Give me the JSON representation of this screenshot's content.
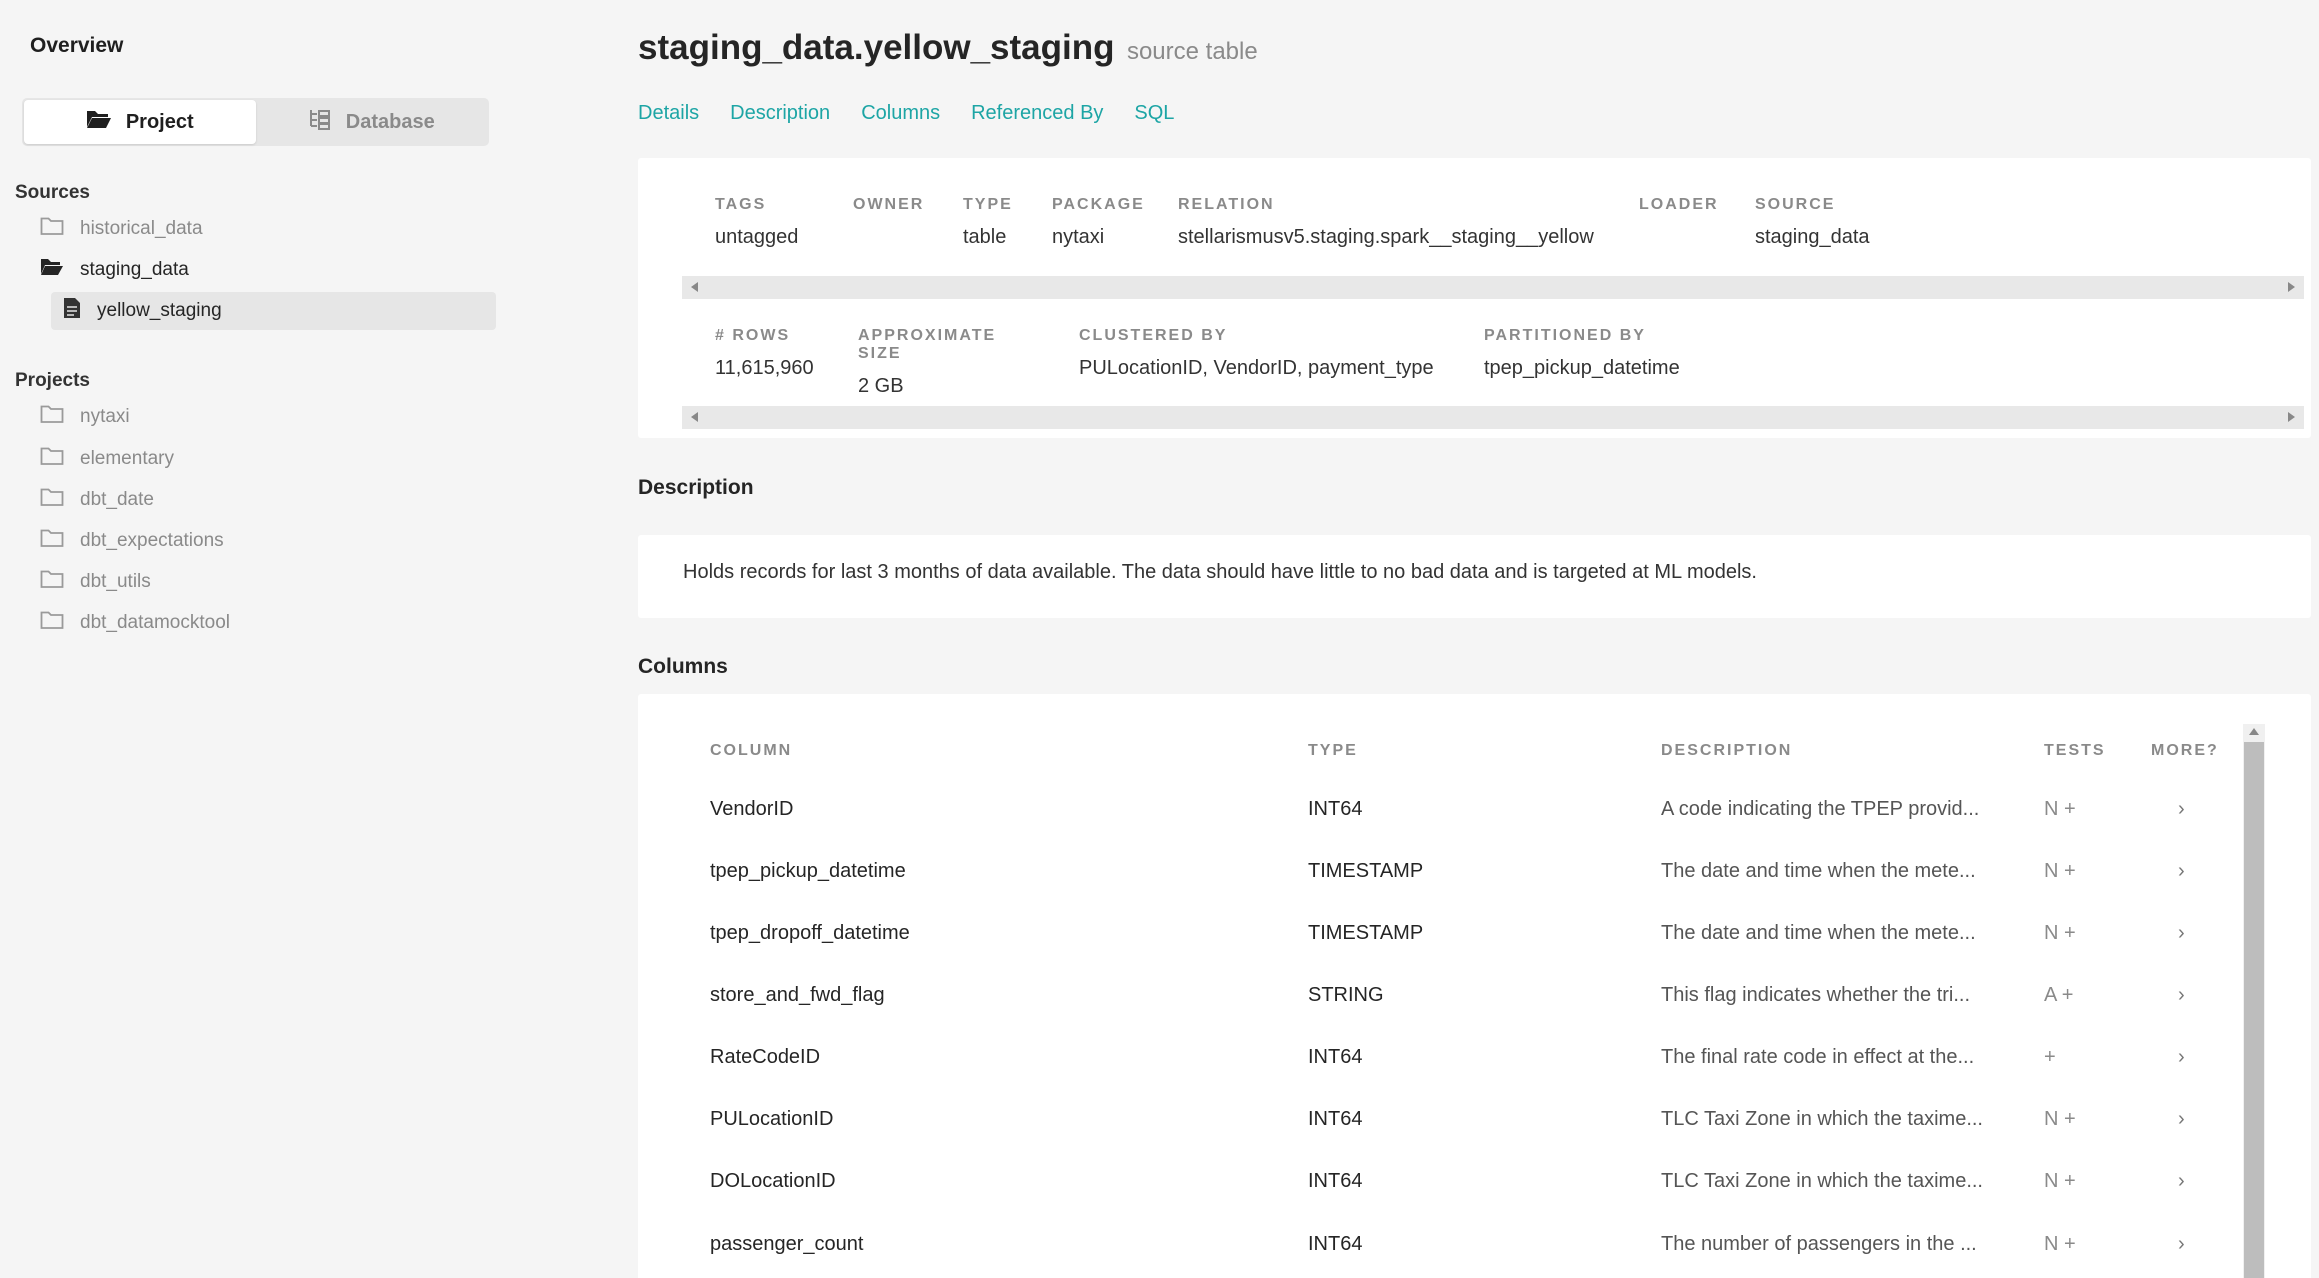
{
  "sidebar": {
    "overview": "Overview",
    "switch": {
      "project": "Project",
      "database": "Database"
    },
    "sources_title": "Sources",
    "sources": [
      {
        "label": "historical_data"
      },
      {
        "label": "staging_data"
      },
      {
        "label": "yellow_staging"
      }
    ],
    "projects_title": "Projects",
    "projects": [
      {
        "label": "nytaxi"
      },
      {
        "label": "elementary"
      },
      {
        "label": "dbt_date"
      },
      {
        "label": "dbt_expectations"
      },
      {
        "label": "dbt_utils"
      },
      {
        "label": "dbt_datamocktool"
      }
    ]
  },
  "header": {
    "title": "staging_data.yellow_staging",
    "subtitle": "source table",
    "tabs": [
      "Details",
      "Description",
      "Columns",
      "Referenced By",
      "SQL"
    ]
  },
  "details": {
    "row1": [
      {
        "label": "TAGS",
        "value": "untagged"
      },
      {
        "label": "OWNER",
        "value": ""
      },
      {
        "label": "TYPE",
        "value": "table"
      },
      {
        "label": "PACKAGE",
        "value": "nytaxi"
      },
      {
        "label": "RELATION",
        "value": "stellarismusv5.staging.spark__staging__yellow"
      },
      {
        "label": "LOADER",
        "value": ""
      },
      {
        "label": "SOURCE",
        "value": "staging_data"
      }
    ],
    "row2": [
      {
        "label": "# ROWS",
        "value": "11,615,960"
      },
      {
        "label": "APPROXIMATE SIZE",
        "value": "2 GB"
      },
      {
        "label": "CLUSTERED BY",
        "value": "PULocationID, VendorID, payment_type"
      },
      {
        "label": "PARTITIONED BY",
        "value": "tpep_pickup_datetime"
      }
    ]
  },
  "description": {
    "heading": "Description",
    "text": "Holds records for last 3 months of data available. The data should have little to no bad data and is targeted at ML models."
  },
  "columns": {
    "heading": "Columns",
    "headers": {
      "column": "COLUMN",
      "type": "TYPE",
      "description": "DESCRIPTION",
      "tests": "TESTS",
      "more": "MORE?"
    },
    "rows": [
      {
        "name": "VendorID",
        "type": "INT64",
        "description": "A code indicating the TPEP provid...",
        "tests": "N +",
        "more": "›"
      },
      {
        "name": "tpep_pickup_datetime",
        "type": "TIMESTAMP",
        "description": "The date and time when the mete...",
        "tests": "N +",
        "more": "›"
      },
      {
        "name": "tpep_dropoff_datetime",
        "type": "TIMESTAMP",
        "description": "The date and time when the mete...",
        "tests": "N +",
        "more": "›"
      },
      {
        "name": "store_and_fwd_flag",
        "type": "STRING",
        "description": "This flag indicates whether the tri...",
        "tests": "A +",
        "more": "›"
      },
      {
        "name": "RateCodeID",
        "type": "INT64",
        "description": "The final rate code in effect at the...",
        "tests": "+",
        "more": "›"
      },
      {
        "name": "PULocationID",
        "type": "INT64",
        "description": "TLC Taxi Zone in which the taxime...",
        "tests": "N +",
        "more": "›"
      },
      {
        "name": "DOLocationID",
        "type": "INT64",
        "description": "TLC Taxi Zone in which the taxime...",
        "tests": "N +",
        "more": "›"
      },
      {
        "name": "passenger_count",
        "type": "INT64",
        "description": "The number of passengers in the ...",
        "tests": "N +",
        "more": "›"
      }
    ]
  },
  "colors": {
    "accent": "#1da5a5",
    "muted": "#8a8a8a",
    "background": "#f5f5f5"
  }
}
